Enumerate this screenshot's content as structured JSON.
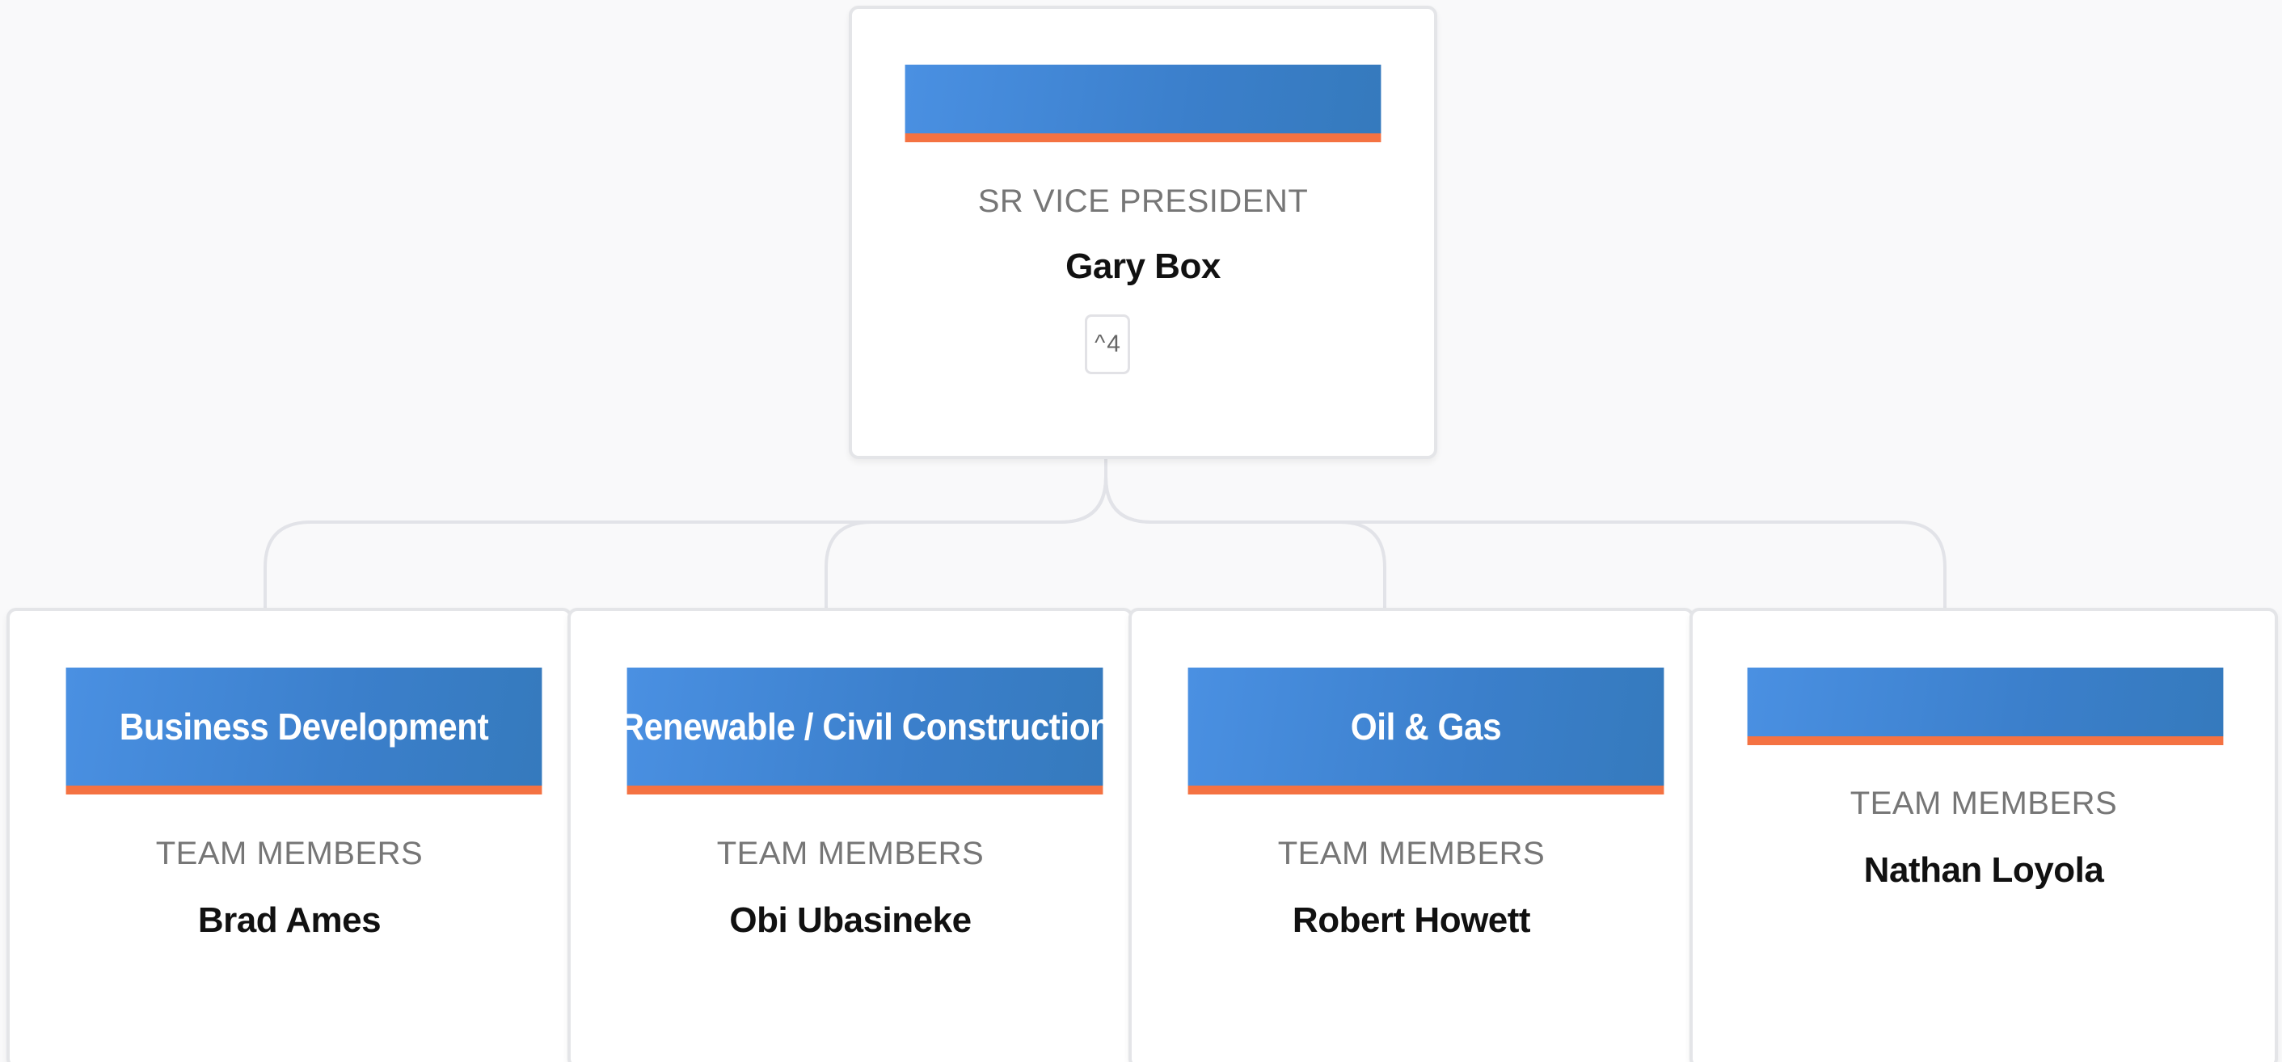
{
  "root": {
    "title": "SR VICE PRESIDENT",
    "name": "Gary Box",
    "children_count": "4",
    "toggle_icon": "chevron-up-icon"
  },
  "children": [
    {
      "team": "Business Development",
      "label": "TEAM MEMBERS",
      "member": "Brad Ames"
    },
    {
      "team": "Renewable / Civil Construction",
      "label": "TEAM MEMBERS",
      "member": "Obi Ubasineke"
    },
    {
      "team": "Oil & Gas",
      "label": "TEAM MEMBERS",
      "member": "Robert Howett"
    },
    {
      "team": "",
      "label": "TEAM MEMBERS",
      "member": "Nathan Loyola"
    }
  ],
  "colors": {
    "banner_blue": "#4a90e2",
    "banner_accent": "#f47242",
    "connector": "#e2e3e8",
    "background": "#f9f9fa"
  }
}
